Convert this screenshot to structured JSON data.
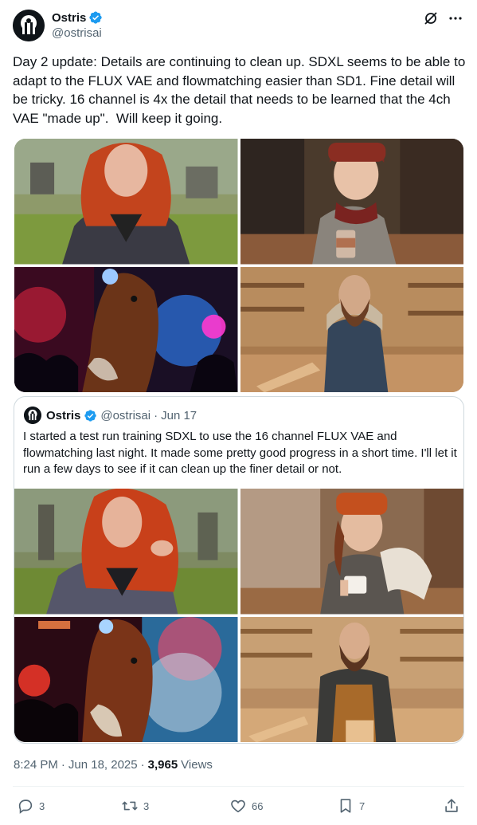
{
  "author": {
    "name": "Ostris",
    "handle": "@ostrisai",
    "verified": true,
    "avatar_icon": "ostris-logo"
  },
  "header_icons": [
    "grok-slash-icon",
    "more-icon"
  ],
  "tweet": {
    "text": "Day 2 update: Details are continuing to clean up. SDXL seems to be able to adapt to the FLUX VAE and flowmatching easier than SD1. Fine detail will be tricky. 16 channel is 4x the detail that needs to be learned that the 4ch VAE \"made up\".  Will keep it going."
  },
  "media": [
    {
      "subject": "red-haired woman in park"
    },
    {
      "subject": "woman in red beanie holding coffee cup"
    },
    {
      "subject": "horse head in neon nightclub"
    },
    {
      "subject": "bearded man in woodworking shop"
    }
  ],
  "quote": {
    "name": "Ostris",
    "handle": "@ostrisai",
    "separator": "·",
    "date": "Jun 17",
    "text": "I started a test run training SDXL to use the 16 channel FLUX VAE and flowmatching last night. It made some pretty good progress in a short time. I'll let it run a few days to see if it can clean up the finer detail or not.",
    "media": [
      {
        "subject": "red-haired woman in park"
      },
      {
        "subject": "woman in orange beanie holding coffee cup"
      },
      {
        "subject": "horse head in neon club"
      },
      {
        "subject": "bearded man in woodworking shop"
      }
    ]
  },
  "meta": {
    "time": "8:24 PM",
    "sep1": "·",
    "date": "Jun 18, 2025",
    "sep2": "·",
    "views_count": "3,965",
    "views_label": "Views"
  },
  "actions": {
    "replies": "3",
    "reposts": "3",
    "likes": "66",
    "bookmarks": "7"
  },
  "colors": {
    "text": "#0f1419",
    "secondary": "#536471",
    "verified": "#1d9bf0",
    "border": "#cfd9de"
  }
}
